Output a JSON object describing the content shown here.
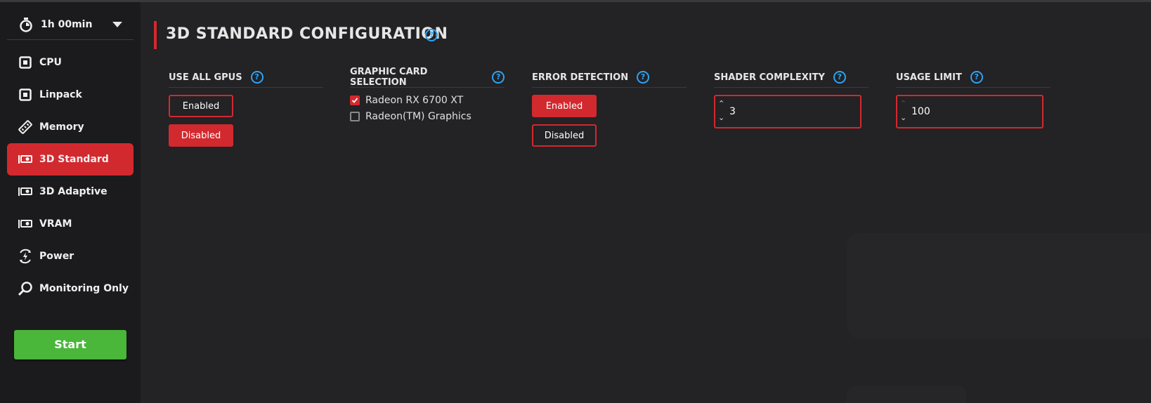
{
  "sidebar": {
    "timer": {
      "label": "1h 00min"
    },
    "items": [
      {
        "label": "CPU",
        "icon": "cpu-icon"
      },
      {
        "label": "Linpack",
        "icon": "linpack-icon"
      },
      {
        "label": "Memory",
        "icon": "memory-icon"
      },
      {
        "label": "3D Standard",
        "icon": "gpu-icon",
        "active": true
      },
      {
        "label": "3D Adaptive",
        "icon": "gpu-icon"
      },
      {
        "label": "VRAM",
        "icon": "gpu-icon"
      },
      {
        "label": "Power",
        "icon": "power-icon"
      },
      {
        "label": "Monitoring Only",
        "icon": "magnifier-icon"
      }
    ],
    "start_label": "Start"
  },
  "main": {
    "title": "3D STANDARD CONFIGURATION",
    "help_symbol": "?",
    "sections": {
      "use_all_gpus": {
        "title": "USE ALL GPUS",
        "enabled_label": "Enabled",
        "disabled_label": "Disabled",
        "selected": "Disabled"
      },
      "graphic_card": {
        "title": "GRAPHIC CARD SELECTION",
        "cards": [
          {
            "label": "Radeon RX 6700 XT",
            "checked": true
          },
          {
            "label": "Radeon(TM) Graphics",
            "checked": false
          }
        ]
      },
      "error_detection": {
        "title": "ERROR DETECTION",
        "enabled_label": "Enabled",
        "disabled_label": "Disabled",
        "selected": "Enabled"
      },
      "shader_complexity": {
        "title": "SHADER COMPLEXITY",
        "value": "3"
      },
      "usage_limit": {
        "title": "USAGE LIMIT",
        "value": "100"
      }
    }
  },
  "colors": {
    "accent": "#d2292f",
    "start": "#4ab63a",
    "help": "#2ea3f2",
    "background": "#232224",
    "sidebar": "#1b1b1d"
  }
}
